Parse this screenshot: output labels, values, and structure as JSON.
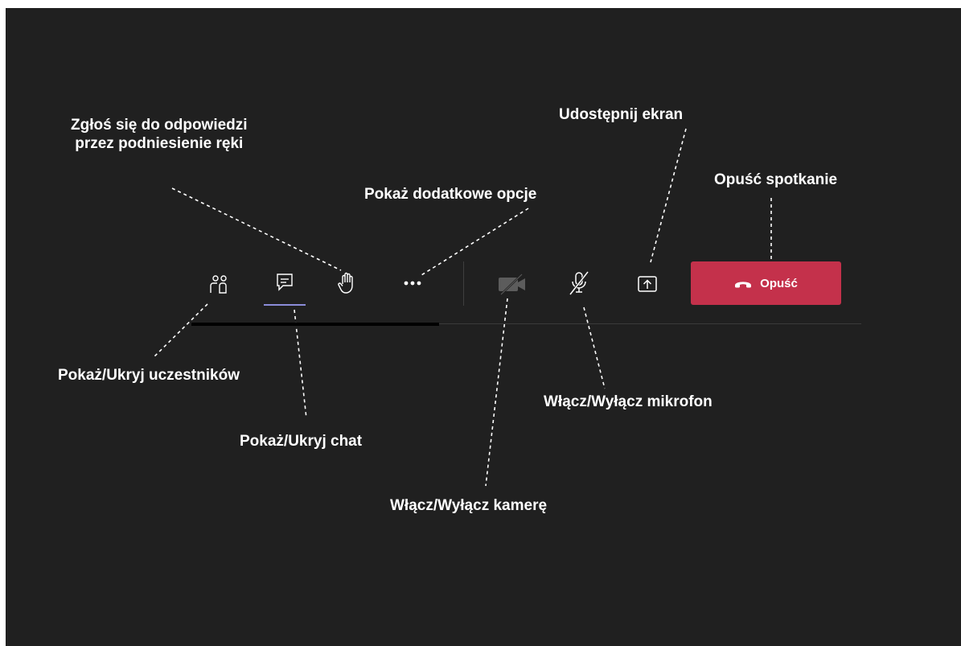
{
  "annotations": {
    "raise_hand_line1": "Zgłoś się do odpowiedzi",
    "raise_hand_line2": "przez podniesienie ręki",
    "more_options": "Pokaż dodatkowe opcje",
    "share_screen": "Udostępnij ekran",
    "leave_meeting": "Opuść spotkanie",
    "participants": "Pokaż/Ukryj uczestników",
    "chat": "Pokaż/Ukryj chat",
    "microphone": "Włącz/Wyłącz mikrofon",
    "camera": "Włącz/Wyłącz kamerę"
  },
  "toolbar": {
    "leave_label": "Opuść",
    "icons": [
      "participants-icon",
      "chat-icon",
      "raise-hand-icon",
      "more-options-icon",
      "camera-off-icon",
      "mic-off-icon",
      "share-screen-icon",
      "phone-hangup-icon"
    ]
  },
  "colors": {
    "background": "#202020",
    "leave_button": "#c4314b",
    "active_underline": "#8b8cd9",
    "camera_disabled": "#5c5c5c",
    "icon": "#ffffff"
  }
}
